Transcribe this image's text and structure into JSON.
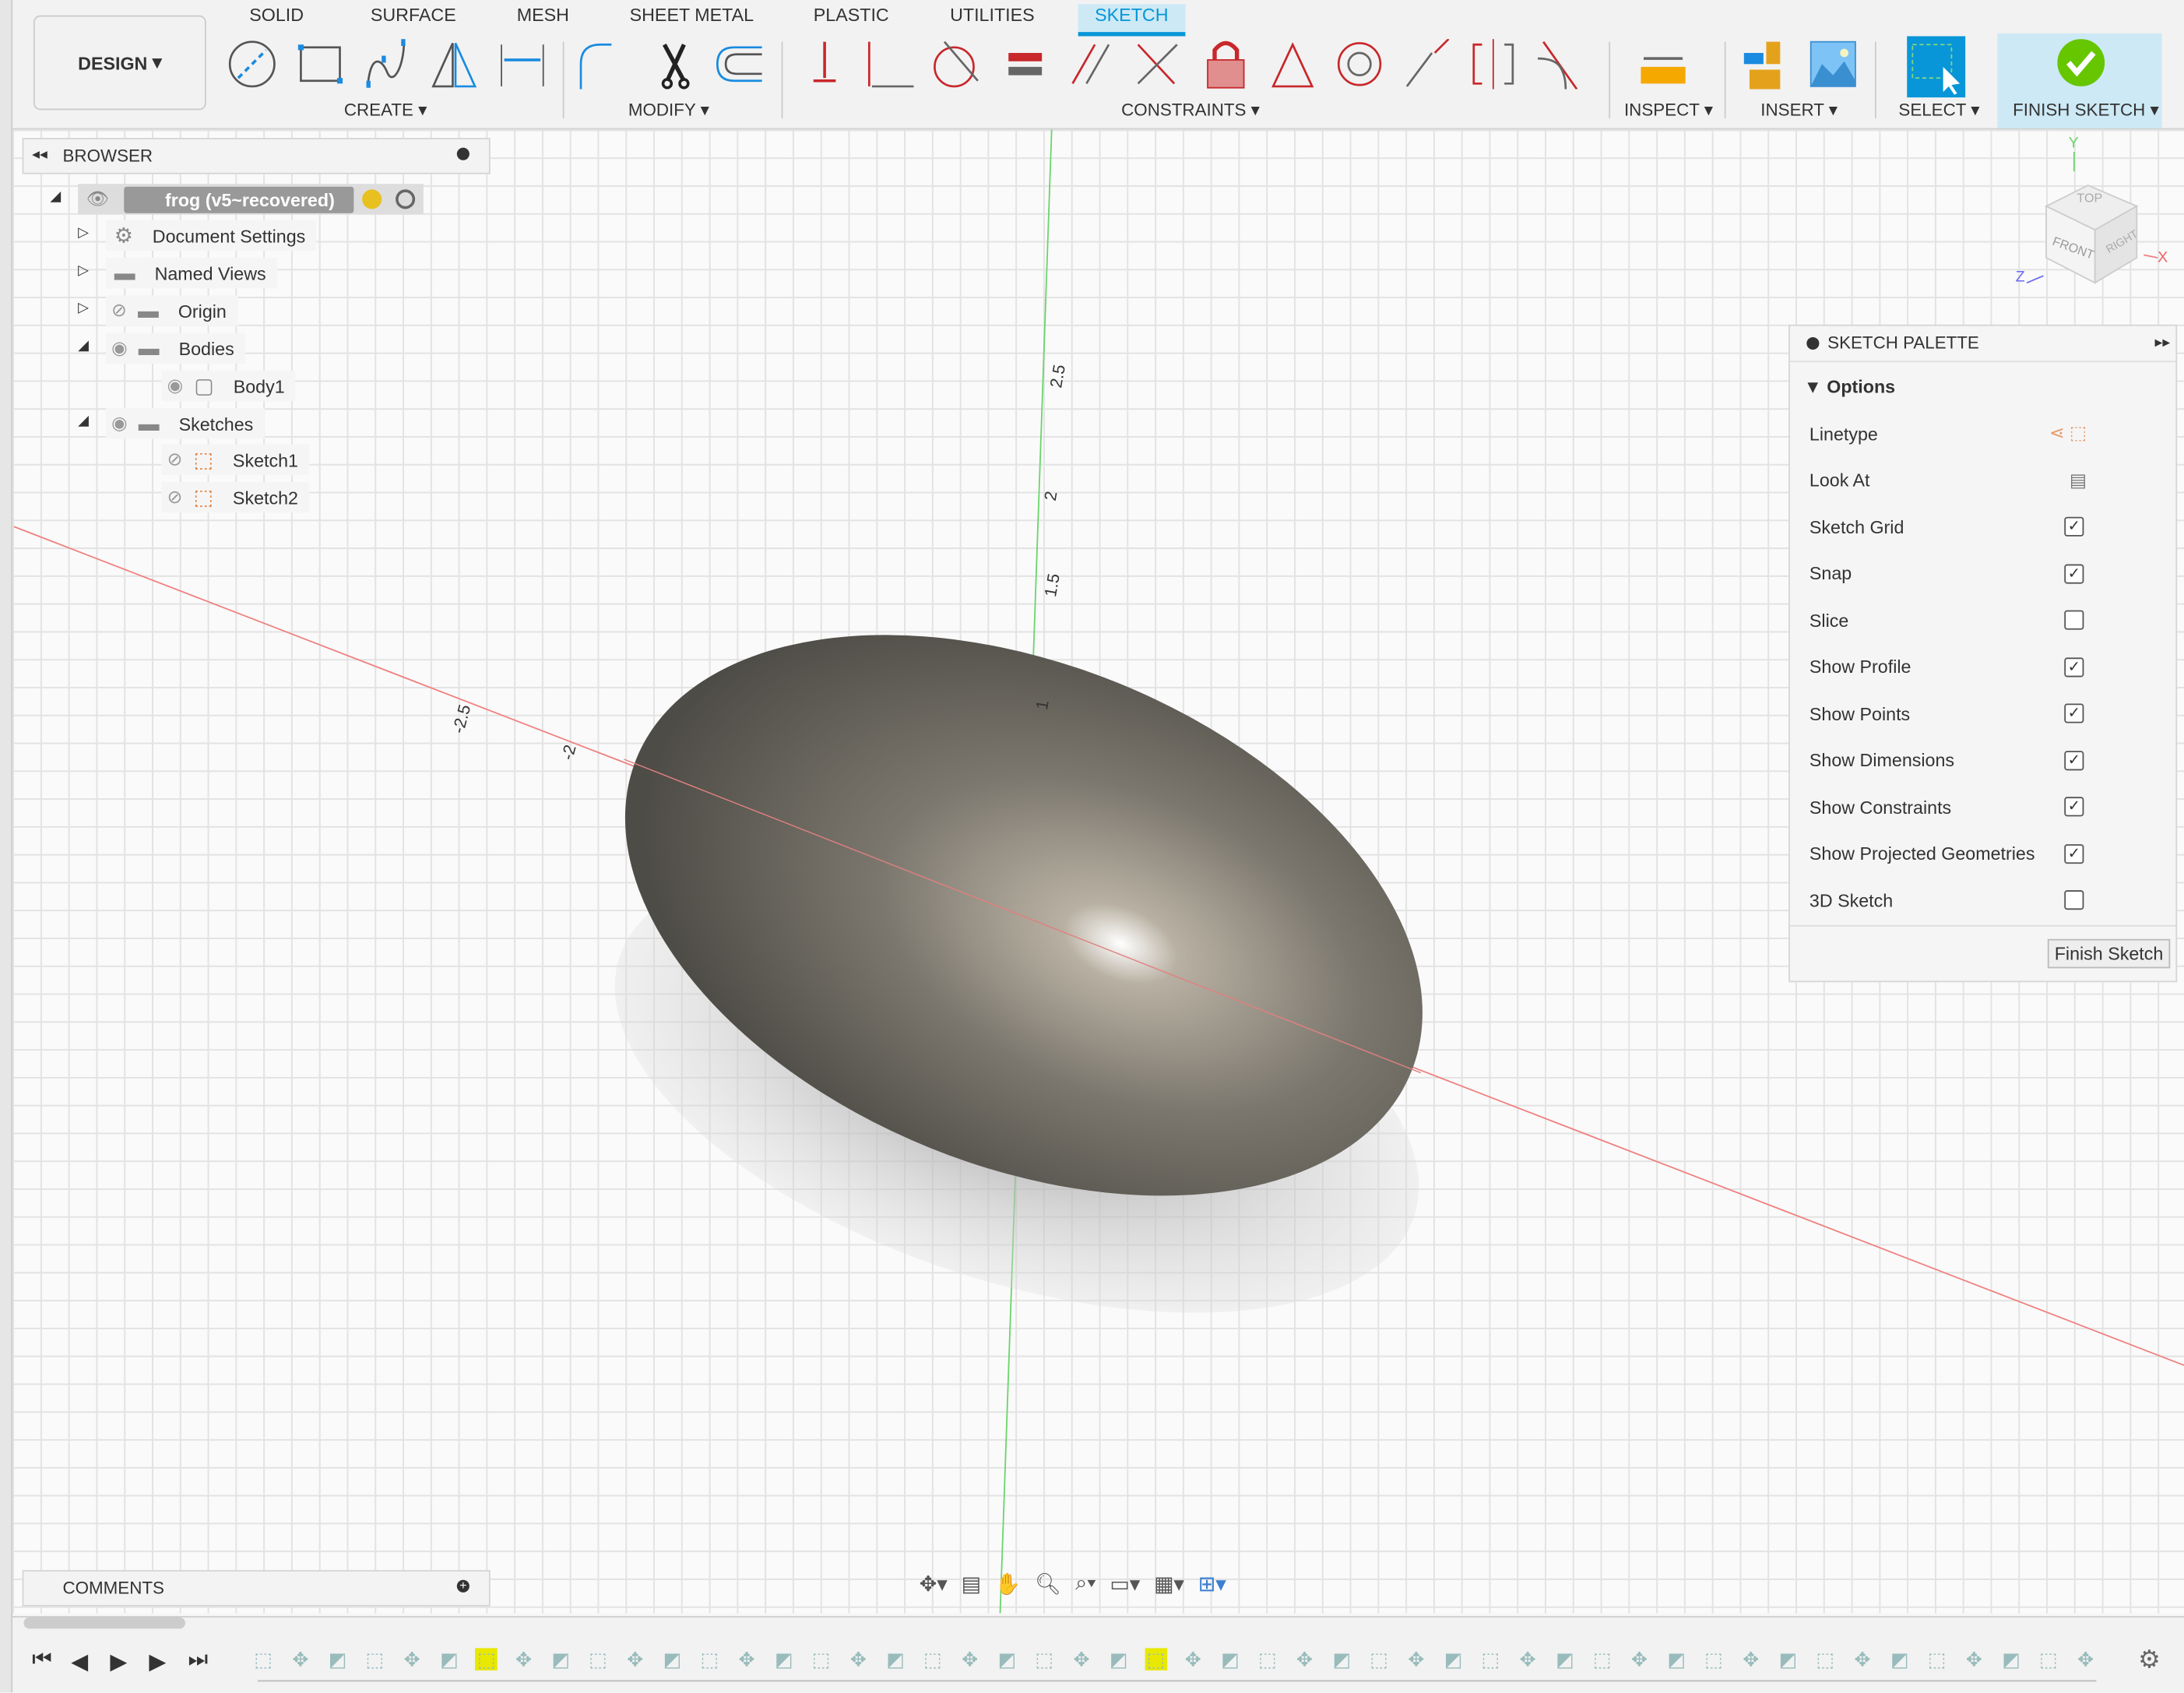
{
  "workspace": {
    "label": "DESIGN"
  },
  "tabs": [
    {
      "label": "SOLID"
    },
    {
      "label": "SURFACE"
    },
    {
      "label": "MESH"
    },
    {
      "label": "SHEET METAL"
    },
    {
      "label": "PLASTIC"
    },
    {
      "label": "UTILITIES"
    },
    {
      "label": "SKETCH"
    }
  ],
  "groups": {
    "create": "CREATE",
    "modify": "MODIFY",
    "constraints": "CONSTRAINTS",
    "inspect": "INSPECT",
    "insert": "INSERT",
    "select": "SELECT",
    "finish": "FINISH SKETCH"
  },
  "browser": {
    "title": "BROWSER",
    "root": "frog (v5~recovered)",
    "items": [
      {
        "label": "Document Settings"
      },
      {
        "label": "Named Views"
      },
      {
        "label": "Origin"
      },
      {
        "label": "Bodies"
      },
      {
        "label": "Body1"
      },
      {
        "label": "Sketches"
      },
      {
        "label": "Sketch1"
      },
      {
        "label": "Sketch2"
      }
    ]
  },
  "axis_labels": {
    "y25": "2.5",
    "y2": "2",
    "y15": "1.5",
    "y1": "1",
    "x25": "-2.5",
    "x2": "-2"
  },
  "viewcube": {
    "top": "TOP",
    "front": "FRONT",
    "right": "RIGHT",
    "x": "X",
    "y": "Y",
    "z": "Z"
  },
  "palette": {
    "title": "SKETCH PALETTE",
    "section": "Options",
    "rows": [
      {
        "label": "Linetype"
      },
      {
        "label": "Look At"
      },
      {
        "label": "Sketch Grid",
        "checked": true
      },
      {
        "label": "Snap",
        "checked": true
      },
      {
        "label": "Slice",
        "checked": false
      },
      {
        "label": "Show Profile",
        "checked": true
      },
      {
        "label": "Show Points",
        "checked": true
      },
      {
        "label": "Show Dimensions",
        "checked": true
      },
      {
        "label": "Show Constraints",
        "checked": true
      },
      {
        "label": "Show Projected Geometries",
        "checked": true
      },
      {
        "label": "3D Sketch",
        "checked": false
      }
    ],
    "finish_button": "Finish Sketch"
  },
  "comments": {
    "title": "COMMENTS"
  },
  "colors": {
    "accent": "#0696d7",
    "finish": "#66c600",
    "constraint": "#c8272b"
  }
}
